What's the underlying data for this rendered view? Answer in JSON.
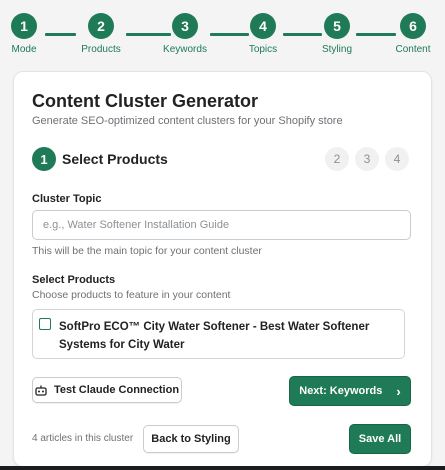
{
  "stepper": {
    "steps": [
      {
        "number": "1",
        "label": "Mode"
      },
      {
        "number": "2",
        "label": "Products"
      },
      {
        "number": "3",
        "label": "Keywords"
      },
      {
        "number": "4",
        "label": "Topics"
      },
      {
        "number": "5",
        "label": "Styling"
      },
      {
        "number": "6",
        "label": "Content"
      }
    ]
  },
  "header": {
    "title": "Content Cluster Generator",
    "subtitle": "Generate SEO-optimized content clusters for your Shopify store"
  },
  "section": {
    "number": "1",
    "title": "Select Products",
    "upcoming_steps": [
      "2",
      "3",
      "4"
    ]
  },
  "cluster_topic": {
    "label": "Cluster Topic",
    "value": "",
    "placeholder": "e.g., Water Softener Installation Guide",
    "help": "This will be the main topic for your content cluster"
  },
  "products": {
    "label": "Select Products",
    "help": "Choose products to feature in your content",
    "items": [
      {
        "name": "SoftPro ECO™ City Water Softener - Best Water Softener Systems for City Water",
        "checked": false
      }
    ]
  },
  "actions": {
    "test_connection": "Test Claude Connection",
    "next": "Next: Keywords",
    "article_count": "4 articles in this cluster",
    "back": "Back to Styling",
    "save_all": "Save All"
  },
  "colors": {
    "accent": "#1f7a57",
    "background": "#f3f4f3"
  }
}
